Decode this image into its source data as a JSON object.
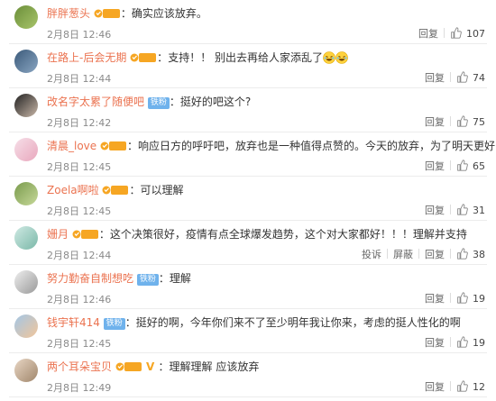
{
  "comments": [
    {
      "user": "胖胖葱头",
      "badge": "orange",
      "badge_text": "铁粉",
      "text": "确实应该放弃。",
      "date": "2月8日 12:46",
      "actions": [
        "回复"
      ],
      "likes": "107"
    },
    {
      "user": "在路上-后会无期",
      "badge": "orange",
      "badge_text": "铁粉",
      "text": "支持！！ 别出去再给人家添乱了",
      "emoji": true,
      "date": "2月8日 12:44",
      "actions": [
        "回复"
      ],
      "likes": "74"
    },
    {
      "user": "改名字太累了随便吧",
      "badge": "blue",
      "badge_text": "铁粉",
      "text": "挺好的吧这个?",
      "date": "2月8日 12:42",
      "actions": [
        "回复"
      ],
      "likes": "75"
    },
    {
      "user": "清晨_love",
      "badge": "orange",
      "badge_text": "铁粉",
      "text": "响应日方的呼吁吧，放弃也是一种值得点赞的。今天的放弃，为了明天更好！",
      "date": "2月8日 12:45",
      "actions": [
        "回复"
      ],
      "likes": "65"
    },
    {
      "user": "Zoela啊啦",
      "badge": "orange",
      "badge_text": "铁粉",
      "text": "可以理解",
      "date": "2月8日 12:45",
      "actions": [
        "回复"
      ],
      "likes": "31"
    },
    {
      "user": "姗月",
      "badge": "orange",
      "badge_text": "铁粉",
      "text": "这个决策很好，疫情有点全球爆发趋势，这个对大家都好！！！理解并支持",
      "date": "2月8日 12:44",
      "actions": [
        "投诉",
        "屏蔽",
        "回复"
      ],
      "likes": "38"
    },
    {
      "user": "努力勤奋自制想吃",
      "badge": "blue",
      "badge_text": "铁粉",
      "text": "理解",
      "date": "2月8日 12:46",
      "actions": [
        "回复"
      ],
      "likes": "19"
    },
    {
      "user": "钱宇轩414",
      "badge": "blue",
      "badge_text": "铁粉",
      "text": "挺好的啊，今年你们来不了至少明年我让你来，考虑的挺人性化的啊",
      "date": "2月8日 12:45",
      "actions": [
        "回复"
      ],
      "likes": "19"
    },
    {
      "user": "两个耳朵宝贝",
      "badge": "orange",
      "badge_text": "铁粉",
      "vip": true,
      "text": "理解理解 应该放弃",
      "date": "2月8日 12:49",
      "actions": [
        "回复"
      ],
      "likes": "12"
    }
  ],
  "colors": {
    "username": "#eb7350",
    "badge_blue": "#6fb2ec",
    "badge_orange": "#f6a623"
  },
  "icons": {
    "like": "thumbs-up-icon",
    "badge": "fan-badge-icon",
    "vip": "v-badge-icon",
    "emoji": "laughing-emoji-icon"
  }
}
